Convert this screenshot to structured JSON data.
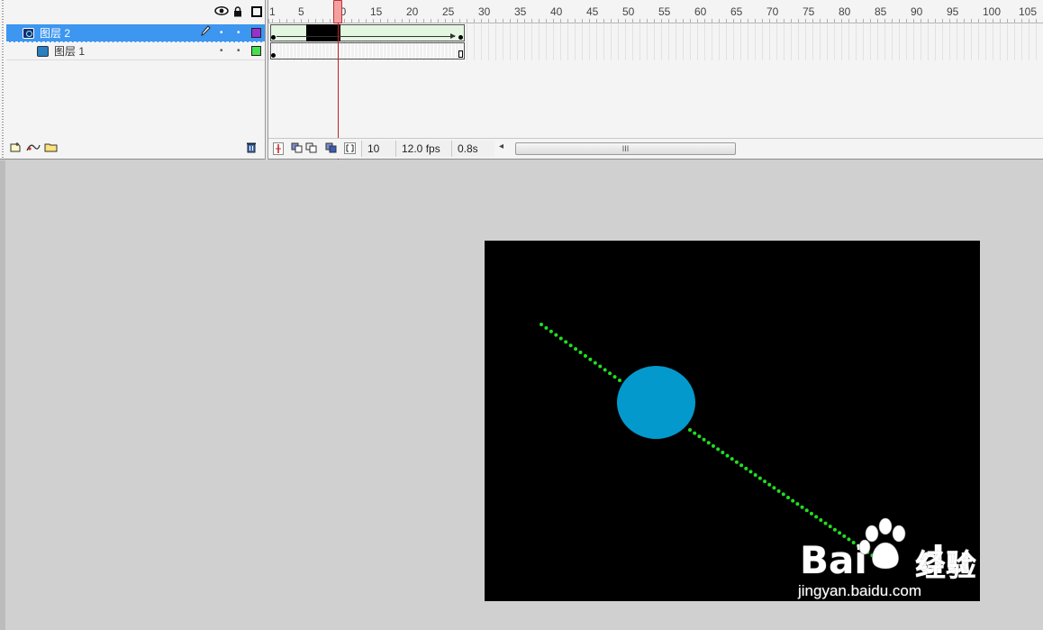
{
  "timeline": {
    "layers": [
      {
        "name": "图层 2",
        "selected": true,
        "color": "#9a2fd0"
      },
      {
        "name": "图层 1",
        "selected": false,
        "color": "#44e050"
      }
    ],
    "ruler_numbers": [
      "1",
      "5",
      "10",
      "15",
      "20",
      "25",
      "30",
      "35",
      "40",
      "45",
      "50",
      "55",
      "60",
      "65",
      "70",
      "75",
      "80",
      "85",
      "90",
      "95",
      "100",
      "105"
    ],
    "current_frame": "10",
    "fps": "12.0 fps",
    "elapsed_time": "0.8s",
    "scroll_thumb_label": "III",
    "scroll_left_arrow": "◂"
  },
  "icons": {
    "eye": "eye-icon",
    "lock": "lock-icon",
    "outline": "outline-icon",
    "pencil": "pencil-icon",
    "trash": "trash-icon"
  },
  "stage": {
    "background": "#000000",
    "ball_color": "#0499cd",
    "path_color": "#22dd22"
  },
  "watermark": {
    "brand": "Bai",
    "brand_suffix": "du",
    "cn": "经验",
    "url": "jingyan.baidu.com"
  }
}
